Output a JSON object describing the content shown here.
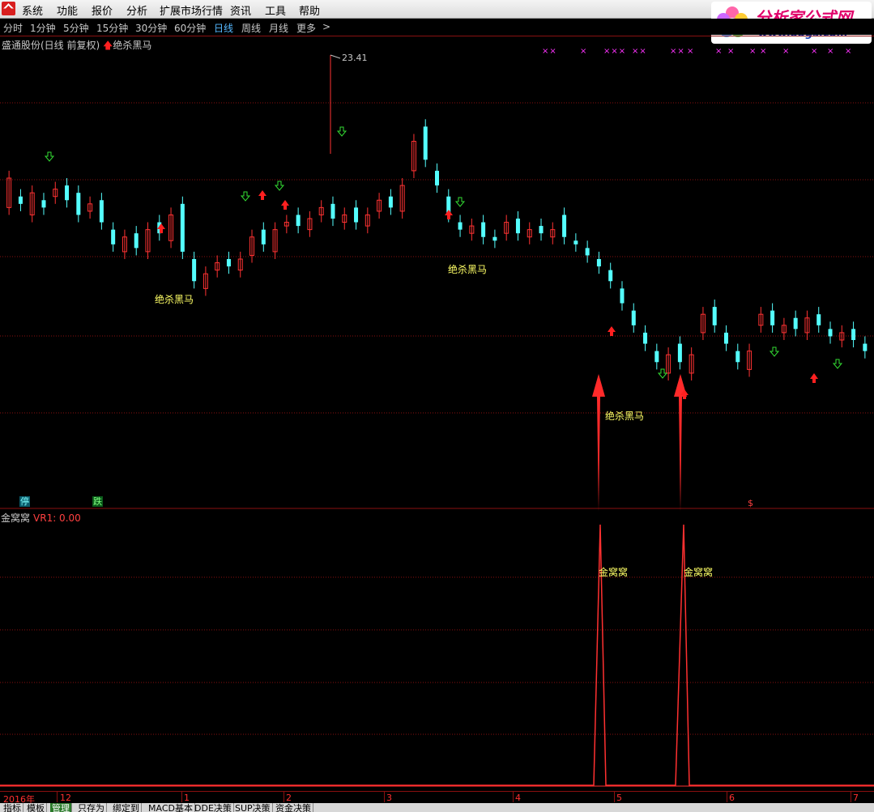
{
  "menu": [
    "系统",
    "功能",
    "报价",
    "分析",
    "扩展市场行情",
    "资讯",
    "工具",
    "帮助"
  ],
  "brand": {
    "name": "分析家公式网",
    "url": "www.88gs.com"
  },
  "periods": [
    {
      "label": "分时",
      "active": false
    },
    {
      "label": "1分钟",
      "active": false
    },
    {
      "label": "5分钟",
      "active": false
    },
    {
      "label": "15分钟",
      "active": false
    },
    {
      "label": "30分钟",
      "active": false
    },
    {
      "label": "60分钟",
      "active": false
    },
    {
      "label": "日线",
      "active": true
    },
    {
      "label": "周线",
      "active": false
    },
    {
      "label": "月线",
      "active": false
    },
    {
      "label": "更多",
      "active": false
    },
    {
      "label": ">",
      "active": false
    }
  ],
  "chart": {
    "title": "盛通股份(日线 前复权)",
    "signal_arrow": "🡅",
    "signal_label": "绝杀黑马",
    "max_price_label": "23.41",
    "annotations": [
      "绝杀黑马",
      "绝杀黑马",
      "绝杀黑马"
    ],
    "badges": [
      "停",
      "跌",
      "$"
    ],
    "x_marks": [
      "××",
      "×",
      "×××",
      "××",
      "××",
      "×",
      "×",
      "×",
      "×",
      "×",
      "×",
      "×",
      "×",
      "×"
    ]
  },
  "chart_data": {
    "type": "candlestick",
    "title": "盛通股份(日线 前复权)",
    "max_label": 23.41,
    "candles": [
      [
        0,
        1,
        0.92,
        0.95
      ],
      [
        1,
        0.95,
        0.93,
        0.96
      ],
      [
        0,
        0.96,
        0.9,
        0.92
      ],
      [
        1,
        0.92,
        0.94,
        0.95
      ],
      [
        0,
        0.95,
        0.97,
        0.99
      ],
      [
        1,
        0.98,
        0.94,
        0.96
      ],
      [
        1,
        0.96,
        0.9,
        0.91
      ],
      [
        0,
        0.91,
        0.93,
        0.94
      ],
      [
        1,
        0.94,
        0.88,
        0.86
      ],
      [
        1,
        0.86,
        0.82,
        0.8
      ],
      [
        0,
        0.8,
        0.84,
        0.85
      ],
      [
        1,
        0.85,
        0.81,
        0.8
      ],
      [
        0,
        0.8,
        0.86,
        0.88
      ],
      [
        1,
        0.88,
        0.85,
        0.83
      ],
      [
        0,
        0.83,
        0.9,
        0.93
      ],
      [
        1,
        0.93,
        0.8,
        0.78
      ],
      [
        1,
        0.78,
        0.72,
        0.7
      ],
      [
        0,
        0.7,
        0.74,
        0.75
      ],
      [
        0,
        0.75,
        0.77,
        0.78
      ],
      [
        1,
        0.78,
        0.76,
        0.75
      ],
      [
        0,
        0.75,
        0.78,
        0.79
      ],
      [
        0,
        0.79,
        0.84,
        0.86
      ],
      [
        1,
        0.86,
        0.82,
        0.8
      ],
      [
        0,
        0.8,
        0.86,
        0.87
      ],
      [
        0,
        0.87,
        0.88,
        0.9
      ],
      [
        1,
        0.9,
        0.87,
        0.86
      ],
      [
        0,
        0.86,
        0.89,
        0.9
      ],
      [
        0,
        0.9,
        0.92,
        0.93
      ],
      [
        1,
        0.93,
        0.89,
        0.88
      ],
      [
        0,
        0.88,
        0.9,
        0.92
      ],
      [
        1,
        0.92,
        0.88,
        0.87
      ],
      [
        0,
        0.87,
        0.9,
        0.91
      ],
      [
        0,
        0.91,
        0.94,
        0.95
      ],
      [
        1,
        0.95,
        0.92,
        0.91
      ],
      [
        0,
        0.91,
        0.98,
        1.02
      ],
      [
        0,
        1.02,
        1.1,
        1.14
      ],
      [
        1,
        1.14,
        1.05,
        1.02
      ],
      [
        1,
        1.02,
        0.98,
        0.95
      ],
      [
        1,
        0.95,
        0.9,
        0.88
      ],
      [
        1,
        0.88,
        0.86,
        0.85
      ],
      [
        0,
        0.85,
        0.87,
        0.88
      ],
      [
        1,
        0.88,
        0.84,
        0.83
      ],
      [
        1,
        0.83,
        0.84,
        0.85
      ],
      [
        0,
        0.85,
        0.88,
        0.89
      ],
      [
        1,
        0.89,
        0.85,
        0.84
      ],
      [
        0,
        0.84,
        0.86,
        0.87
      ],
      [
        1,
        0.87,
        0.85,
        0.84
      ],
      [
        0,
        0.84,
        0.86,
        0.9
      ],
      [
        1,
        0.9,
        0.84,
        0.83
      ],
      [
        1,
        0.83,
        0.82,
        0.81
      ],
      [
        1,
        0.81,
        0.79,
        0.78
      ],
      [
        1,
        0.78,
        0.76,
        0.75
      ],
      [
        1,
        0.75,
        0.72,
        0.7
      ],
      [
        1,
        0.7,
        0.66,
        0.64
      ],
      [
        1,
        0.64,
        0.6,
        0.58
      ],
      [
        1,
        0.58,
        0.55,
        0.53
      ],
      [
        1,
        0.53,
        0.5,
        0.47
      ],
      [
        0,
        0.47,
        0.52,
        0.55
      ],
      [
        1,
        0.55,
        0.5,
        0.47
      ],
      [
        0,
        0.47,
        0.52,
        0.58
      ],
      [
        0,
        0.58,
        0.63,
        0.65
      ],
      [
        1,
        0.65,
        0.6,
        0.58
      ],
      [
        1,
        0.58,
        0.55,
        0.53
      ],
      [
        1,
        0.53,
        0.5,
        0.48
      ],
      [
        0,
        0.48,
        0.53,
        0.6
      ],
      [
        0,
        0.6,
        0.63,
        0.64
      ],
      [
        1,
        0.64,
        0.6,
        0.58
      ],
      [
        0,
        0.58,
        0.6,
        0.62
      ],
      [
        1,
        0.62,
        0.59,
        0.58
      ],
      [
        0,
        0.58,
        0.62,
        0.63
      ],
      [
        1,
        0.63,
        0.6,
        0.59
      ],
      [
        1,
        0.59,
        0.57,
        0.56
      ],
      [
        0,
        0.56,
        0.58,
        0.59
      ],
      [
        1,
        0.59,
        0.56,
        0.55
      ],
      [
        1,
        0.55,
        0.53,
        0.52
      ]
    ]
  },
  "indicator": {
    "name": "金窝窝",
    "vr_label": "VR1: 0.00",
    "annotations": [
      "金窝窝",
      "金窝窝"
    ],
    "spike_values": [
      0,
      1,
      0,
      1,
      0
    ]
  },
  "dates": [
    "2016年",
    "12",
    "1",
    "2",
    "3",
    "4",
    "5",
    "6",
    "7"
  ],
  "tabs": [
    {
      "label": "指标",
      "active": false
    },
    {
      "label": "模板",
      "active": false
    },
    {
      "label": "管理",
      "active": true
    },
    {
      "label": "只存为",
      "active": false
    },
    {
      "label": "绑定到",
      "active": false
    },
    {
      "label": "MACD基本",
      "active": false
    },
    {
      "label": "DDE决策",
      "active": false
    },
    {
      "label": "SUP决策",
      "active": false
    },
    {
      "label": "资金决策",
      "active": false
    }
  ],
  "colors": {
    "up": "#ff3232",
    "down": "#54ffff",
    "grid": "#8a1010",
    "label": "#ffff66",
    "xmark": "#ff33ff"
  }
}
